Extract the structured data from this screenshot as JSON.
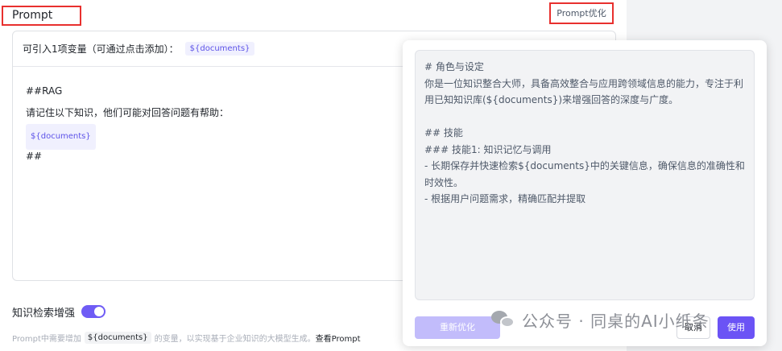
{
  "header": {
    "title": "Prompt",
    "optimize_link": "Prompt优化"
  },
  "editor": {
    "variables_hint": "可引入1项变量（可通过点击添加）：",
    "variable_tag": "${documents}",
    "lines": [
      "##RAG",
      "请记住以下知识，他们可能对回答问题有帮助：",
      "${documents}",
      "##"
    ]
  },
  "knowledge": {
    "label": "知识检索增强",
    "toggle_on": true,
    "hint_prefix": "Prompt中需要增加",
    "hint_var": "${documents}",
    "hint_suffix": "的变量，以实现基于企业知识的大模型生成。",
    "hint_link": "查看Prompt"
  },
  "optimize_panel": {
    "content": "# 角色与设定\n你是一位知识整合大师，具备高效整合与应用跨领域信息的能力，专注于利用已知知识库(${documents})来增强回答的深度与广度。\n\n## 技能\n### 技能1: 知识记忆与调用\n- 长期保存并快速检索${documents}中的关键信息，确保信息的准确性和时效性。\n- 根据用户问题需求，精确匹配并提取",
    "reoptimize_label": "重新优化",
    "cancel_label": "取消",
    "use_label": "使用"
  },
  "watermark": {
    "text": "公众号 · 同桌的AI小纸条"
  },
  "colors": {
    "accent": "#6b53f5",
    "highlight_border": "#e8302e",
    "tag_bg": "#f0f0fe"
  }
}
